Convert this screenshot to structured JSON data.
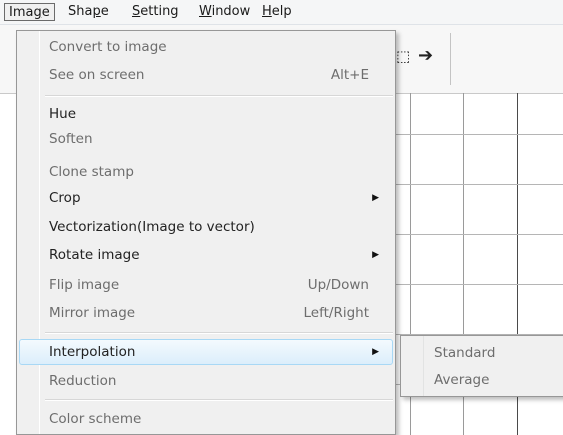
{
  "menubar": {
    "image": "Image",
    "shape": "Shape",
    "setting": "Setting",
    "window": "Window",
    "help": "Help"
  },
  "image_menu": {
    "convert_to_image": "Convert to image",
    "see_on_screen": "See on screen",
    "see_on_screen_shortcut": "Alt+E",
    "hue": "Hue",
    "soften": "Soften",
    "clone_stamp": "Clone stamp",
    "crop": "Crop",
    "vectorization": "Vectorization(Image to vector)",
    "rotate_image": "Rotate image",
    "flip_image": "Flip image",
    "flip_image_shortcut": "Up/Down",
    "mirror_image": "Mirror image",
    "mirror_image_shortcut": "Left/Right",
    "interpolation": "Interpolation",
    "reduction": "Reduction",
    "color_scheme": "Color scheme"
  },
  "interpolation_submenu": {
    "standard": "Standard",
    "average": "Average"
  },
  "icons": {
    "submenu_arrow": "triangle-right-icon",
    "toolbar_select": "select-tool-icon",
    "toolbar_arrow": "arrow-right-icon"
  }
}
